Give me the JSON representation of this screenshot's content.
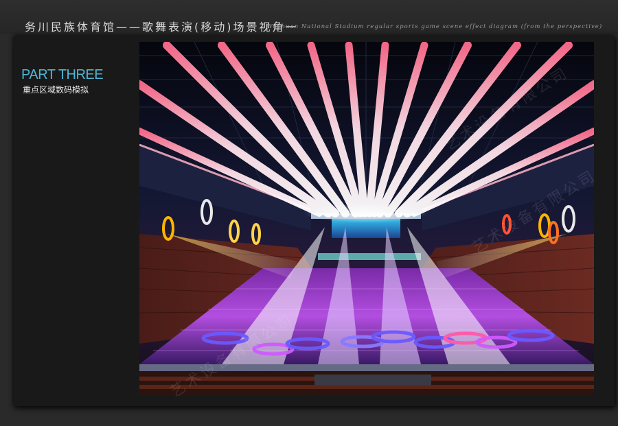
{
  "header": {
    "title_cn": "务川民族体育馆——歌舞表演(移动)场景视角一",
    "title_en": "Wuchuan National Stadium  regular sports game scene effect diagram (from the perspective)"
  },
  "section": {
    "part_title": "PART THREE",
    "subtitle": "重点区域数码模拟"
  },
  "render": {
    "watermark": "艺术设备有限公司"
  },
  "colors": {
    "accent": "#4fb6d4",
    "beam": "#ff8fb0",
    "floor_light": "#b04cff"
  }
}
